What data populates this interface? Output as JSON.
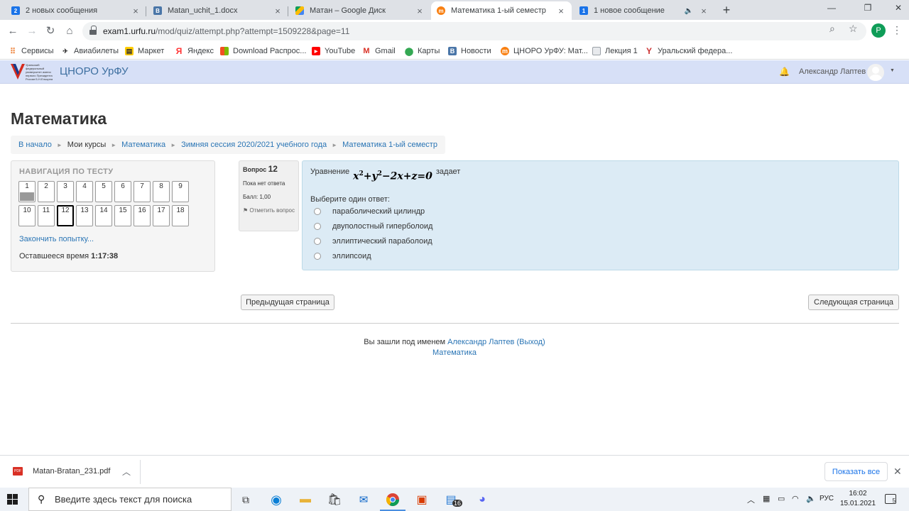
{
  "browser": {
    "tabs": [
      {
        "title": "2 новых сообщения",
        "favicon": "2"
      },
      {
        "title": "Matan_uchit_1.docx",
        "favicon": "vk"
      },
      {
        "title": "Матан – Google Диск",
        "favicon": "drive"
      },
      {
        "title": "Математика 1-ый семестр",
        "favicon": "moodle"
      },
      {
        "title": "1 новое сообщение",
        "favicon": "1"
      }
    ],
    "url_host": "exam1.urfu.ru",
    "url_path": "/mod/quiz/attempt.php?attempt=1509228&page=11",
    "profile_initial": "P",
    "bookmarks": [
      "Сервисы",
      "Авиабилеты",
      "Маркет",
      "Яндекс",
      "Download Распрос...",
      "YouTube",
      "Gmail",
      "Карты",
      "Новости",
      "ЦНОРО УрФУ: Мат...",
      "Лекция 1",
      "Уральский федера..."
    ]
  },
  "header": {
    "site_name": "ЦНОРО УрФУ",
    "logo_text": "Уральский федеральный университет имени первого Президента России Б.Н.Ельцина",
    "user_name": "Александр Лаптев"
  },
  "page": {
    "title": "Математика",
    "breadcrumb": [
      "В начало",
      "Мои курсы",
      "Математика",
      "Зимняя сессия 2020/2021 учебного года",
      "Математика 1-ый семестр"
    ]
  },
  "quiz_nav": {
    "heading": "НАВИГАЦИЯ ПО ТЕСТУ",
    "questions": [
      "1",
      "2",
      "3",
      "4",
      "5",
      "6",
      "7",
      "8",
      "9",
      "10",
      "11",
      "12",
      "13",
      "14",
      "15",
      "16",
      "17",
      "18"
    ],
    "finish_link": "Закончить попытку...",
    "time_label": "Оставшееся время",
    "time_value": "1:17:38"
  },
  "question": {
    "label": "Вопрос",
    "number": "12",
    "status": "Пока нет ответа",
    "grade": "Балл: 1,00",
    "flag_label": "Отметить вопрос",
    "text_before": "Уравнение",
    "text_after": "задает",
    "formula": {
      "x": "x",
      "y": "y",
      "exp": "2",
      "rest": "−2x+z=0"
    },
    "prompt": "Выберите один ответ:",
    "answers": [
      "параболический цилиндр",
      "двуполостный гиперболоид",
      "эллиптический параболоид",
      "эллипсоид"
    ]
  },
  "buttons": {
    "prev": "Предыдущая страница",
    "next": "Следующая страница"
  },
  "footer": {
    "logged_in_prefix": "Вы зашли под именем",
    "user_link": "Александр Лаптев",
    "logout": "(Выход)",
    "course_link": "Математика"
  },
  "downloads": {
    "file": "Matan-Bratan_231.pdf",
    "show_all": "Показать все"
  },
  "taskbar": {
    "search_placeholder": "Введите здесь текст для поиска",
    "lang": "РУС",
    "time": "16:02",
    "date": "15.01.2021",
    "notif_count": "5",
    "files_badge": "16"
  }
}
